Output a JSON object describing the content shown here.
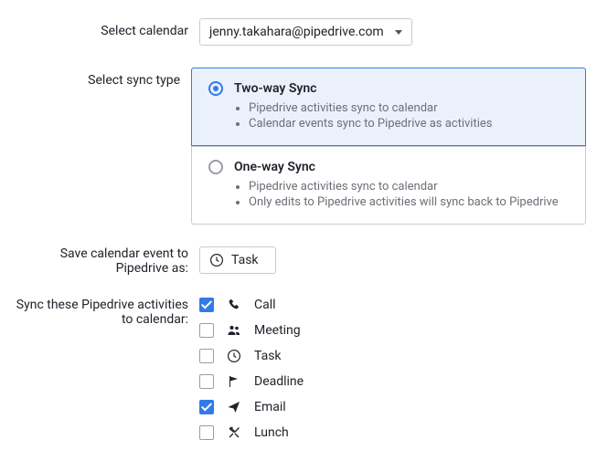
{
  "selectCalendar": {
    "label": "Select calendar",
    "value": "jenny.takahara@pipedrive.com"
  },
  "syncType": {
    "label": "Select sync type",
    "options": [
      {
        "title": "Two-way Sync",
        "bullets": [
          "Pipedrive activities sync to calendar",
          "Calendar events sync to Pipedrive as activities"
        ],
        "selected": true
      },
      {
        "title": "One-way Sync",
        "bullets": [
          "Pipedrive activities sync to calendar",
          "Only edits to Pipedrive activities will sync back to Pipedrive"
        ],
        "selected": false
      }
    ]
  },
  "saveAs": {
    "label": "Save calendar event to Pipedrive as:",
    "value": "Task"
  },
  "activities": {
    "label": "Sync these Pipedrive activities to calendar:",
    "items": [
      {
        "label": "Call",
        "checked": true,
        "icon": "call"
      },
      {
        "label": "Meeting",
        "checked": false,
        "icon": "meeting"
      },
      {
        "label": "Task",
        "checked": false,
        "icon": "task"
      },
      {
        "label": "Deadline",
        "checked": false,
        "icon": "deadline"
      },
      {
        "label": "Email",
        "checked": true,
        "icon": "email"
      },
      {
        "label": "Lunch",
        "checked": false,
        "icon": "lunch"
      }
    ]
  }
}
